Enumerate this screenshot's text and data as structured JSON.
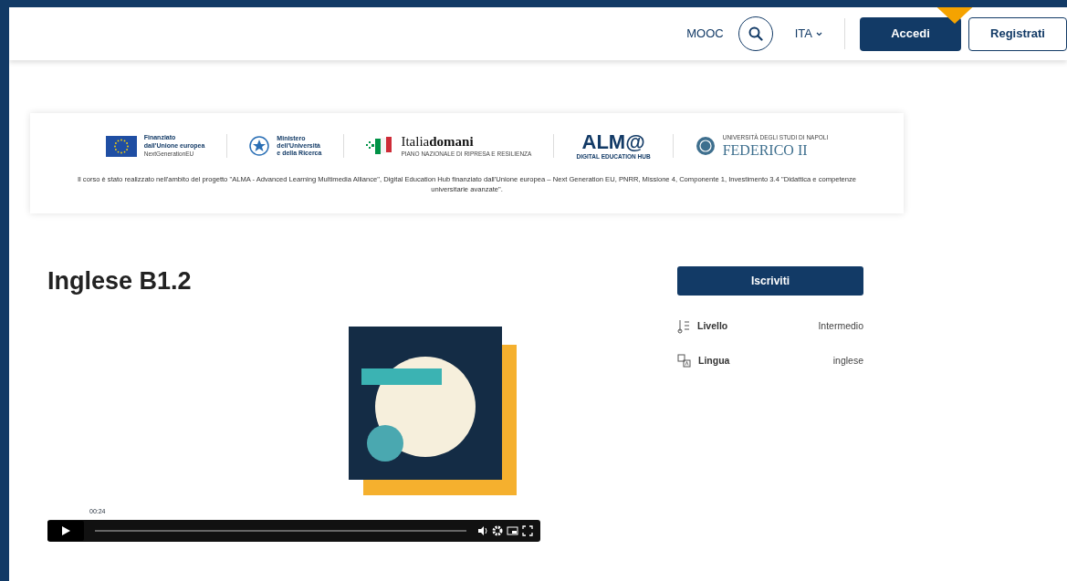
{
  "header": {
    "links": [
      {
        "label": "MOOC"
      }
    ],
    "language": "ITA",
    "buttons": [
      {
        "label": "Accedi",
        "kind": "primary"
      },
      {
        "label": "Registrati",
        "kind": "outline"
      }
    ]
  },
  "sponsors": {
    "logos": [
      {
        "kind": "eu",
        "lines": [
          "Finanziato",
          "dall'Unione europea"
        ],
        "subline": "NextGenerationEU"
      },
      {
        "kind": "ministry",
        "lines": [
          "Ministero",
          "dell'Università",
          "e della Ricerca"
        ]
      },
      {
        "kind": "italiadomani",
        "lines": [
          "Italia**domani**"
        ],
        "subline": "PIANO NAZIONALE DI RIPRESA E RESILIENZA"
      },
      {
        "kind": "alma",
        "lines": [
          "ALM@"
        ],
        "subline": "DIGITAL EDUCATION HUB"
      },
      {
        "kind": "university",
        "lines": [
          "FEDERICO II"
        ],
        "overline": "UNIVERSITÀ DEGLI STUDI DI NAPOLI"
      }
    ],
    "note": "Il corso è stato realizzato nell'ambito del progetto \"ALMA - Advanced Learning Multimedia Alliance\", Digital Education Hub finanziato dall'Unione europea – Next Generation EU, PNRR, Missione 4, Componente 1, Investimento 3.4 \"Didattica e competenze universitarie avanzate\"."
  },
  "course": {
    "title": "Inglese B1.2",
    "enroll_button": "Iscriviti",
    "details": [
      {
        "kind": "level",
        "label": "Livello",
        "value": "Intermedio"
      },
      {
        "kind": "language",
        "label": "Lingua",
        "value": "inglese"
      }
    ],
    "video": {
      "time": "00:24"
    }
  }
}
